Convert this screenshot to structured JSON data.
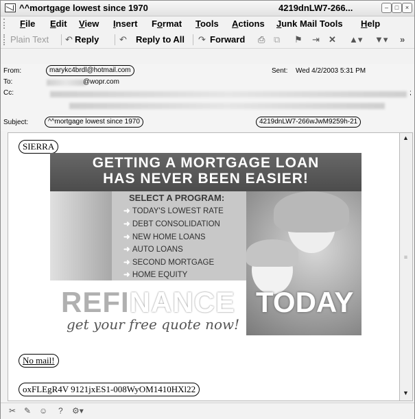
{
  "window": {
    "title": "^^mortgage lowest since 1970",
    "title_right": "4219dnLW7-266...",
    "controls": [
      "–",
      "□",
      "×"
    ]
  },
  "menu": [
    {
      "label": "File",
      "key": "F"
    },
    {
      "label": "Edit",
      "key": "E"
    },
    {
      "label": "View",
      "key": "V"
    },
    {
      "label": "Insert",
      "key": "I"
    },
    {
      "label": "Format",
      "key": "o"
    },
    {
      "label": "Tools",
      "key": "T"
    },
    {
      "label": "Actions",
      "key": "A"
    },
    {
      "label": "Junk Mail Tools",
      "key": "J"
    },
    {
      "label": "Help",
      "key": "H"
    }
  ],
  "toolbar": {
    "plain_text": "Plain Text",
    "reply": "Reply",
    "reply_all": "Reply to All",
    "forward": "Forward",
    "more": "»"
  },
  "header": {
    "from_label": "From:",
    "from_value": "marykc4brdl@hotmail.com",
    "to_label": "To:",
    "to_value": "@wopr.com",
    "cc_label": "Cc:",
    "cc_end": ";",
    "sent_label": "Sent:",
    "sent_value": "Wed 4/2/2003 5:31 PM",
    "subject_label": "Subject:",
    "subject_value": "^^mortgage lowest since 1970",
    "subject_code": "4219dnLW7-266wJwM9259h-21"
  },
  "body": {
    "greeting": "SIERRA",
    "no_mail": "No mail!",
    "code": "oxFLEgR4V 9121jxES1-008WyOM1410HXl22"
  },
  "ad": {
    "headline1": "GETTING A MORTGAGE LOAN",
    "headline2": "HAS NEVER BEEN EASIER!",
    "select": "SELECT A PROGRAM:",
    "programs": [
      "TODAY'S LOWEST RATE",
      "DEBT CONSOLIDATION",
      "NEW HOME LOANS",
      "AUTO LOANS",
      "SECOND MORTGAGE",
      "HOME EQUITY"
    ],
    "refi1": "REFI",
    "refi2": "NANCE",
    "today": "TODAY",
    "quote": "get your free quote now!"
  }
}
